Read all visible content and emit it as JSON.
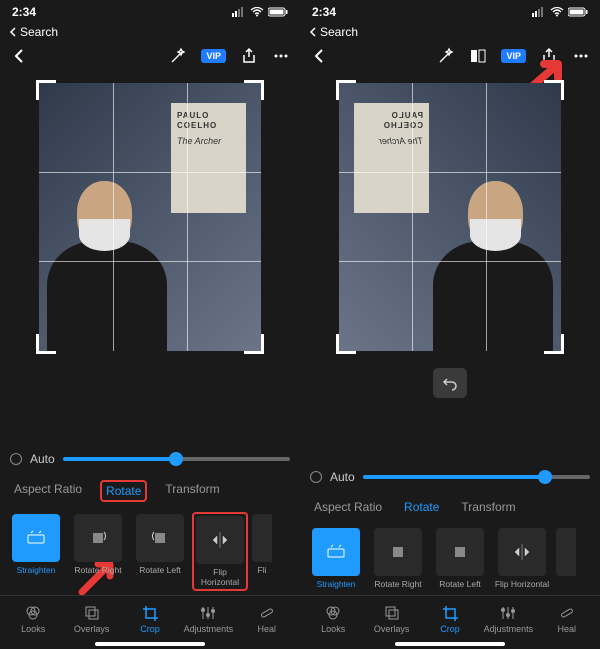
{
  "status": {
    "time": "2:34",
    "back": "Search"
  },
  "vip": "VIP",
  "book": {
    "author": "PAULO COELHO",
    "title": "The Archer"
  },
  "auto": "Auto",
  "slider_left": {
    "pct": 50
  },
  "slider_right": {
    "pct": 80
  },
  "tabs": [
    "Aspect Ratio",
    "Rotate",
    "Transform"
  ],
  "options": [
    {
      "label": "Straighten",
      "active": true,
      "icon": "straighten"
    },
    {
      "label": "Rotate Right",
      "icon": "rot-r"
    },
    {
      "label": "Rotate Left",
      "icon": "rot-l"
    },
    {
      "label": "Flip Horizontal",
      "icon": "flip-h"
    },
    {
      "label": "Flip Vertical",
      "icon": "flip-v",
      "partial": true
    }
  ],
  "bottom": [
    {
      "label": "Looks",
      "icon": "looks"
    },
    {
      "label": "Overlays",
      "icon": "overlays"
    },
    {
      "label": "Crop",
      "icon": "crop",
      "active": true
    },
    {
      "label": "Adjustments",
      "icon": "adjust"
    },
    {
      "label": "Heal",
      "icon": "heal"
    }
  ]
}
